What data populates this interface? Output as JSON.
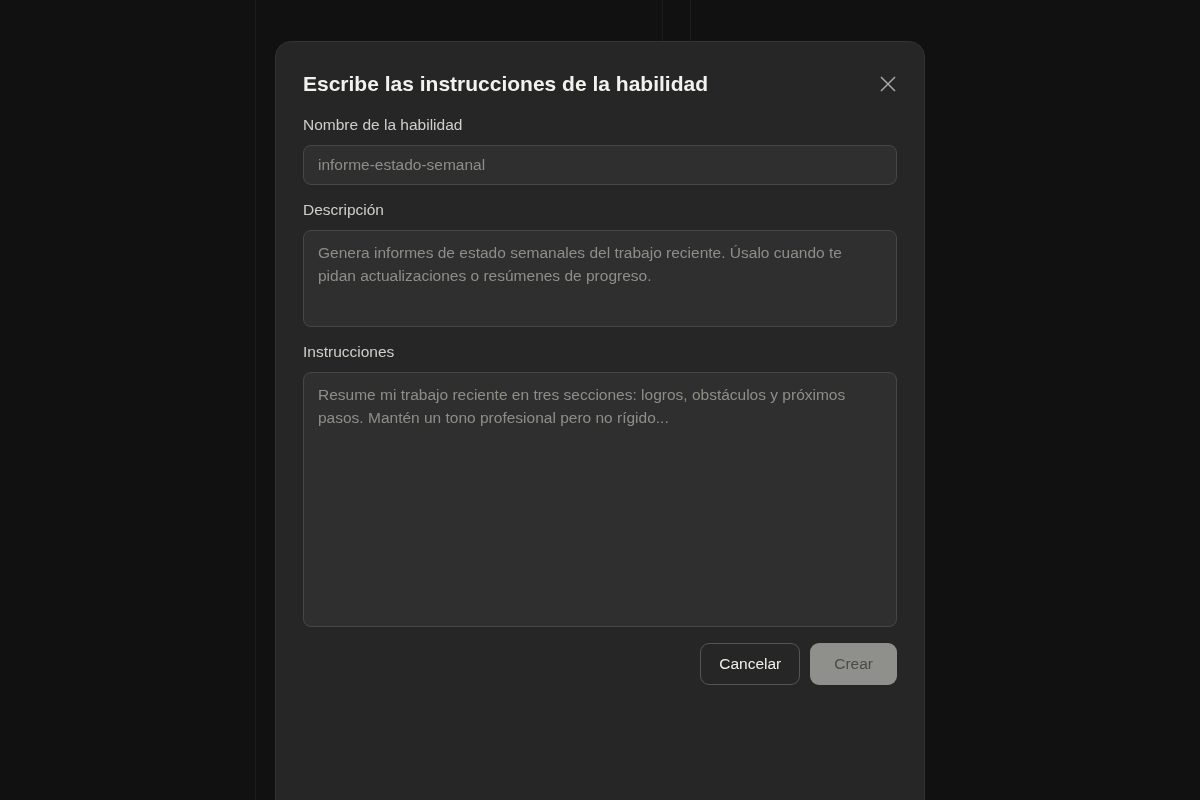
{
  "dialog": {
    "title": "Escribe las instrucciones de la habilidad",
    "fields": [
      {
        "label": "Nombre de la habilidad",
        "kind": "input",
        "placeholder": "informe-estado-semanal"
      },
      {
        "label": "Descripción",
        "kind": "textarea",
        "placeholder": "Genera informes de estado semanales del trabajo reciente. Úsalo cuando te pidan actualizaciones o resúmenes de progreso."
      },
      {
        "label": "Instrucciones",
        "kind": "editor",
        "placeholder": "Resume mi trabajo reciente en tres secciones: logros, obstáculos y próximos pasos. Mantén un tono profesional pero no rígido..."
      }
    ],
    "buttons": [
      {
        "label": "Cancelar",
        "kind": "secondary",
        "disabled": false
      },
      {
        "label": "Crear",
        "kind": "primary",
        "disabled": true
      }
    ]
  }
}
